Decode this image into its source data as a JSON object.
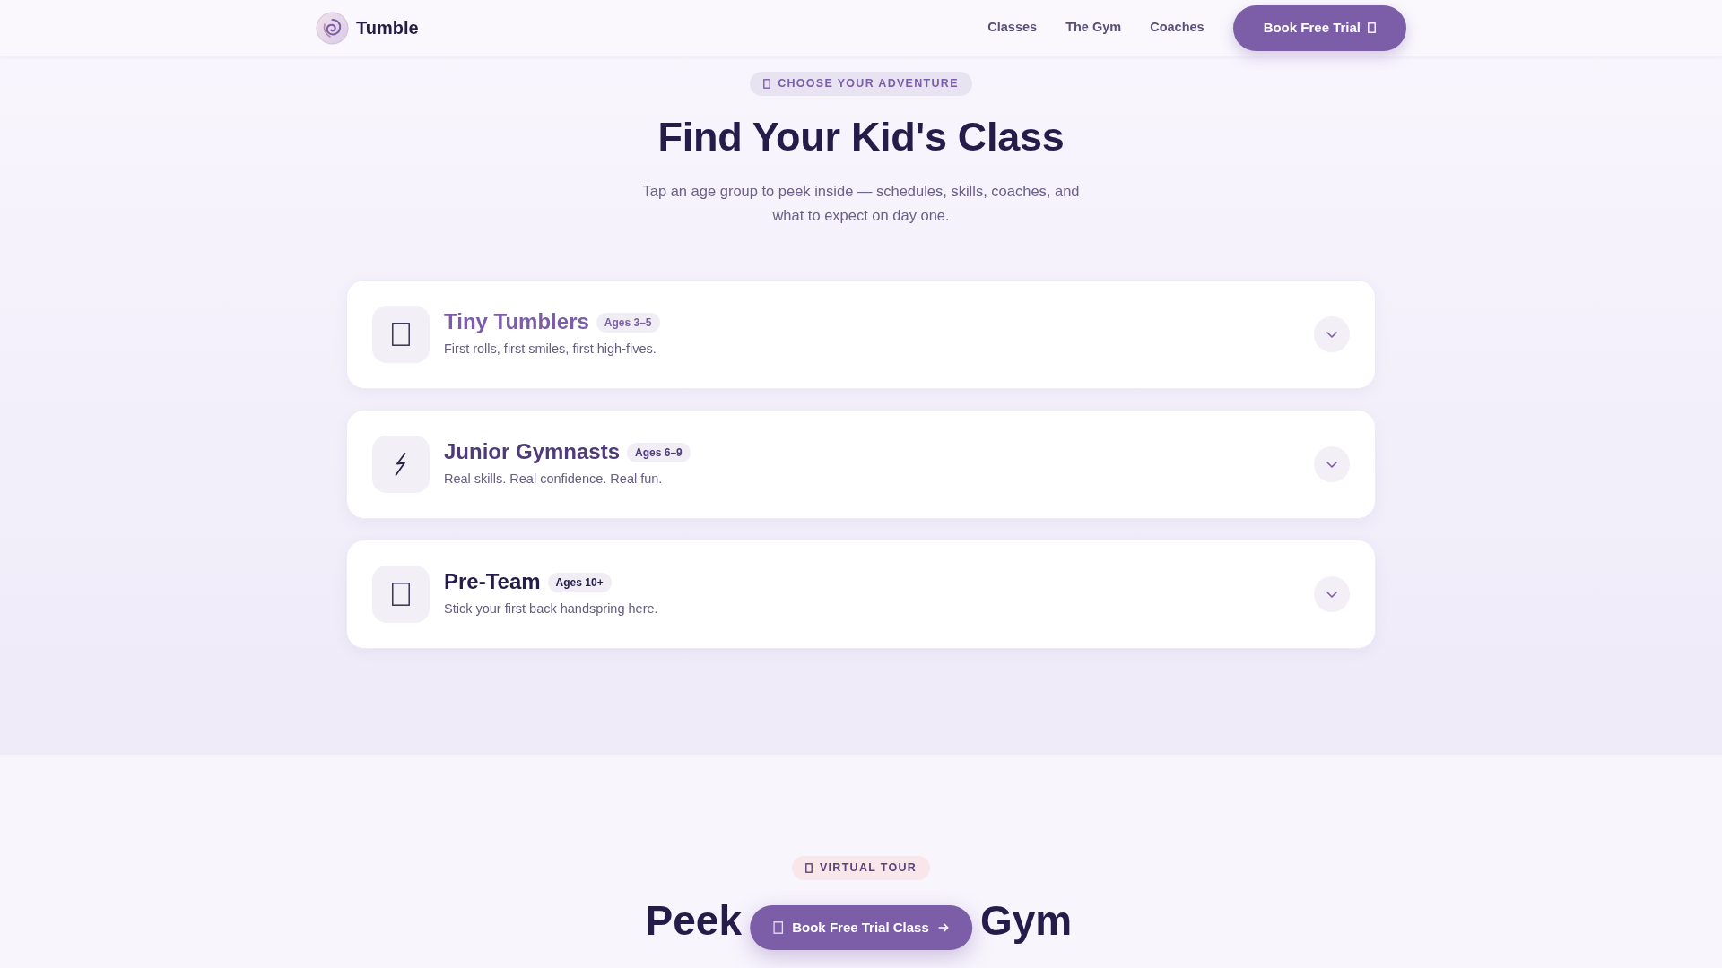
{
  "navbar": {
    "brand": "Tumble",
    "links": [
      {
        "label": "Classes"
      },
      {
        "label": "The Gym"
      },
      {
        "label": "Coaches"
      }
    ],
    "cta": "Book Free Trial"
  },
  "classes_section": {
    "eyebrow": "CHOOSE YOUR ADVENTURE",
    "title": "Find Your Kid's Class",
    "subtitle": "Tap an age group to peek inside — schedules, skills, coaches, and what to expect on day one.",
    "classes": [
      {
        "name": "Tiny Tumblers",
        "ages": "Ages 3–5",
        "tagline": "First rolls, first smiles, first high-fives.",
        "color": "#7a5ea8",
        "expanded": false
      },
      {
        "name": "Junior Gymnasts",
        "ages": "Ages 6–9",
        "tagline": "Real skills. Real confidence. Real fun.",
        "color": "#4f3b7a",
        "expanded": false
      },
      {
        "name": "Pre-Team",
        "ages": "Ages 10+",
        "tagline": "Stick your first back handspring here.",
        "color": "#261c4a",
        "expanded": false
      }
    ]
  },
  "tour_section": {
    "eyebrow": "VIRTUAL TOUR",
    "title_parts": [
      "Peek",
      "Gym"
    ]
  },
  "floating_cta": "Book Free Trial Class"
}
